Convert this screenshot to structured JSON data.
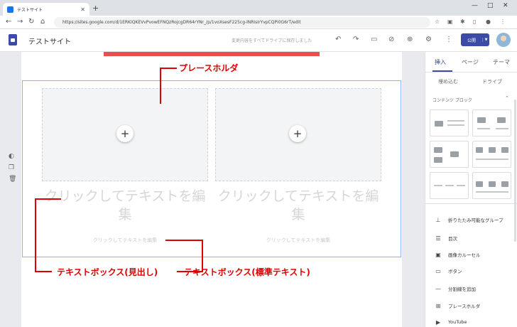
{
  "browser": {
    "tab_title": "テストサイト",
    "url": "https://sites.google.com/d/1ERKIQKEVvPvowEFNQzRojcgDR64rYNr_/p/1voXsesF225cg-lNRisIrYvpCQPi0G6rT/edit",
    "new_tab": "+"
  },
  "app": {
    "site_title": "テストサイト",
    "save_note": "変更内容をすべてドライブに保存しました",
    "publish_label": "公開"
  },
  "canvas": {
    "heading_placeholder": "クリックしてテキストを編集",
    "body_placeholder": "クリックしてテキストを編集"
  },
  "annotations": {
    "placeholder": "プレースホルダ",
    "textbox_heading": "テキストボックス(見出し)",
    "textbox_normal": "テキストボックス(標準テキスト)"
  },
  "panel": {
    "tabs": [
      "挿入",
      "ページ",
      "テーマ"
    ],
    "sub_left": "埋め込む",
    "sub_right": "ドライブ",
    "content_blocks_title": "コンテンツ ブロック",
    "items": [
      {
        "label": "折りたたみ可能なグループ",
        "icon": "expand-icon"
      },
      {
        "label": "目次",
        "icon": "list-icon"
      },
      {
        "label": "画像カルーセル",
        "icon": "carousel-icon"
      },
      {
        "label": "ボタン",
        "icon": "button-icon"
      },
      {
        "label": "分割線を追加",
        "icon": "divider-icon"
      },
      {
        "label": "プレースホルダ",
        "icon": "placeholder-icon"
      },
      {
        "label": "YouTube",
        "icon": "youtube-icon"
      }
    ]
  }
}
